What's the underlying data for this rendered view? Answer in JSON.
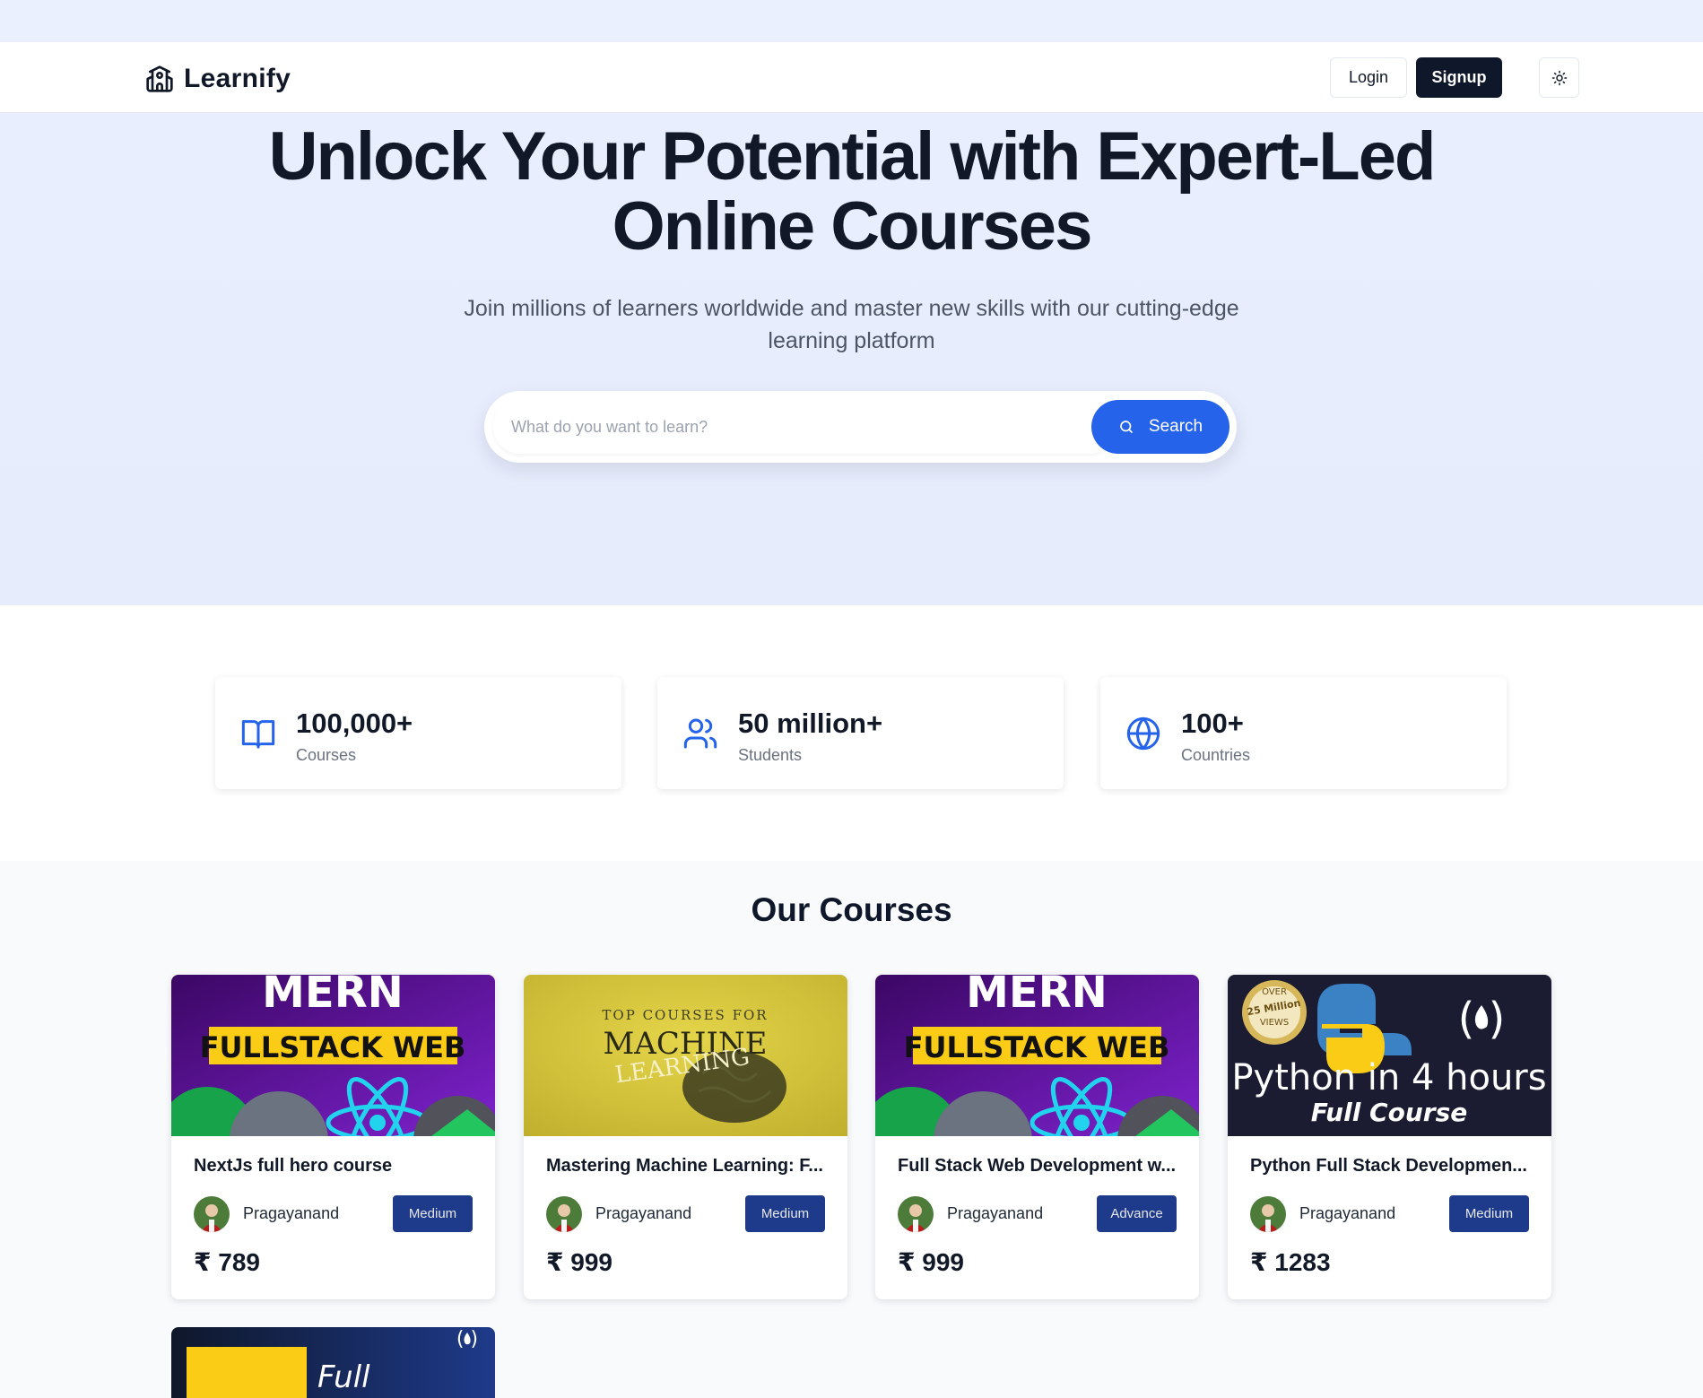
{
  "brand": {
    "name": "Learnify"
  },
  "nav": {
    "login_label": "Login",
    "signup_label": "Signup"
  },
  "hero": {
    "title_line1": "Unlock Your Potential with Expert-Led",
    "title_line2": "Online Courses",
    "subtitle": "Join millions of learners worldwide and master new skills with our cutting-edge learning platform",
    "search_placeholder": "What do you want to learn?",
    "search_button": "Search"
  },
  "stats": [
    {
      "value": "100,000+",
      "label": "Courses",
      "icon": "book-open-icon"
    },
    {
      "value": "50 million+",
      "label": "Students",
      "icon": "users-icon"
    },
    {
      "value": "100+",
      "label": "Countries",
      "icon": "globe-icon"
    }
  ],
  "courses_section": {
    "title": "Our Courses",
    "courses": [
      {
        "title": "NextJs full hero course",
        "instructor": "Pragayanand",
        "level": "Medium",
        "price": "₹ 789",
        "thumb_text_1": "MERN",
        "thumb_text_2": "FULLSTACK WEB"
      },
      {
        "title": "Mastering Machine Learning: F...",
        "instructor": "Pragayanand",
        "level": "Medium",
        "price": "₹ 999",
        "thumb_text_1": "TOP COURSES FOR",
        "thumb_text_2": "MACHINE",
        "thumb_text_3": "LEARNING"
      },
      {
        "title": "Full Stack Web Development w...",
        "instructor": "Pragayanand",
        "level": "Advance",
        "price": "₹ 999",
        "thumb_text_1": "MERN",
        "thumb_text_2": "FULLSTACK WEB"
      },
      {
        "title": "Python Full Stack Developmen...",
        "instructor": "Pragayanand",
        "level": "Medium",
        "price": "₹ 1283",
        "thumb_text_1": "Python in 4 hours",
        "thumb_text_2": "Full Course",
        "thumb_badge_1": "OVER",
        "thumb_badge_2": "25 Million",
        "thumb_badge_3": "VIEWS",
        "thumb_logo": "( )"
      }
    ],
    "partial_thumb_text": "Full"
  },
  "colors": {
    "accent": "#2563eb",
    "dark": "#0f172a",
    "badge": "#1e3a8a",
    "hero_bg": "#e8eefd"
  }
}
